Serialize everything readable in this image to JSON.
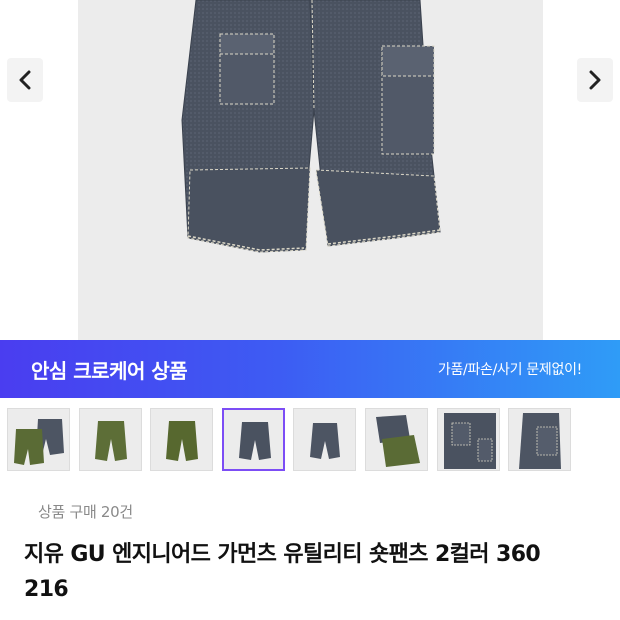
{
  "gallery": {
    "prev_icon": "chevron-left-icon",
    "next_icon": "chevron-right-icon",
    "main_image": "denim-utility-shorts-photo"
  },
  "banner": {
    "title": "안심 크로케어 상품",
    "subtitle": "가품/파손/사기 문제없이!",
    "colors": {
      "start": "#4a3df0",
      "end": "#2f9cf7"
    }
  },
  "thumbnails": [
    {
      "image": "olive-and-denim-shorts-pair",
      "selected": false
    },
    {
      "image": "olive-shorts-front",
      "selected": false
    },
    {
      "image": "olive-shorts-back",
      "selected": false
    },
    {
      "image": "denim-shorts-front",
      "selected": true
    },
    {
      "image": "denim-shorts-back",
      "selected": false
    },
    {
      "image": "folded-shorts-pair",
      "selected": false
    },
    {
      "image": "denim-shorts-detail",
      "selected": false
    },
    {
      "image": "denim-shorts-side-pocket",
      "selected": false
    }
  ],
  "product": {
    "purchase_count": "상품 구매 20건",
    "title_line1": "지유 GU 엔지니어드 가먼츠 유틸리티 숏팬츠 2컬러 360",
    "title_line2": "216"
  },
  "colors": {
    "selected_border": "#7c4df5"
  }
}
